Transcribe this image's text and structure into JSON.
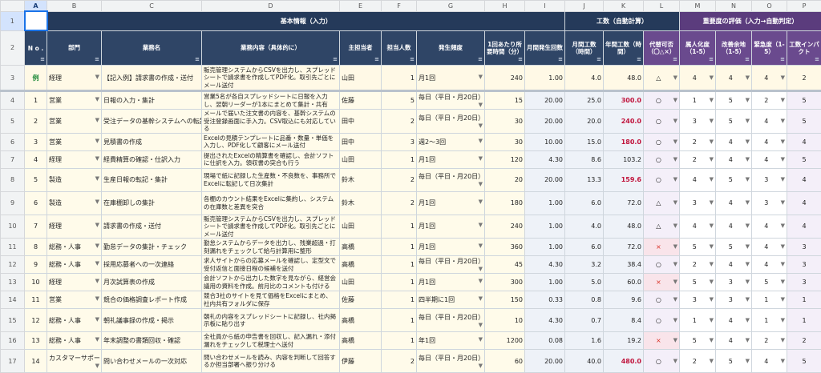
{
  "columns": [
    "A",
    "B",
    "C",
    "D",
    "E",
    "F",
    "G",
    "H",
    "I",
    "J",
    "K",
    "L",
    "M",
    "N",
    "O",
    "P"
  ],
  "selected_column": "A",
  "groups": {
    "basic": "基本情報（入力）",
    "effort": "工数（自動計算）",
    "priority": "重要度の評価（入力→自動判定）"
  },
  "headers": {
    "no": "N o .",
    "dept": "部門",
    "task": "業務名",
    "detail": "業務内容（具体的に）",
    "owner": "主担当者",
    "staff": "担当人数",
    "freq": "発生頻度",
    "time": "1回あたり所要時間（分）",
    "monthly_count": "月間発生回数",
    "monthly_hours": "月間工数（時間）",
    "annual_hours": "年間工数（時間）",
    "automate": "代替可否（〇△×）",
    "personalized": "属人化度（1-5）",
    "room": "改善余地（1-5）",
    "urgency": "緊急度（1-5）",
    "impact": "工数インパクト"
  },
  "example": {
    "rownum": "3",
    "no": "例",
    "dept": "経理",
    "task": "【記入例】請求書の作成・送付",
    "detail": "販売管理システムからCSVを出力し、スプレッドシートで請求書を作成してPDF化。取引先ごとにメール送付",
    "owner": "山田",
    "staff": "1",
    "freq": "月1回",
    "time": "240",
    "monthly_count": "1.00",
    "monthly_hours": "4.0",
    "annual_hours": "48.0",
    "automate": "△",
    "personalized": "4",
    "room": "4",
    "urgency": "4",
    "impact": "2"
  },
  "rows": [
    {
      "rownum": "4",
      "no": "1",
      "dept": "営業",
      "task": "日報の入力・集計",
      "detail": "営業5名が各自スプレッドシートに日報を入力し、翌朝リーダーが1本にまとめて集計・共有",
      "owner": "佐藤",
      "staff": "5",
      "freq": "毎日（平日・月20日）",
      "time": "15",
      "mc": "20.00",
      "mh": "25.0",
      "ah": "300.0",
      "auto": "○",
      "p": "1",
      "r": "5",
      "u": "2",
      "i": "5",
      "red": true,
      "pink": false
    },
    {
      "rownum": "5",
      "no": "2",
      "dept": "営業",
      "task": "受注データの基幹システムへの転記",
      "detail": "メールで届いた注文書の内容を、基幹システムの受注登録画面に手入力。CSV取込にも対応している",
      "owner": "田中",
      "staff": "2",
      "freq": "毎日（平日・月20日）",
      "time": "30",
      "mc": "20.00",
      "mh": "20.0",
      "ah": "240.0",
      "auto": "○",
      "p": "3",
      "r": "5",
      "u": "4",
      "i": "5",
      "red": true,
      "pink": false
    },
    {
      "rownum": "6",
      "no": "3",
      "dept": "営業",
      "task": "見積書の作成",
      "detail": "Excelの見積テンプレートに品番・数量・単価を入力し、PDF化して顧客にメール送付",
      "owner": "田中",
      "staff": "3",
      "freq": "週2〜3回",
      "time": "30",
      "mc": "10.00",
      "mh": "15.0",
      "ah": "180.0",
      "auto": "○",
      "p": "2",
      "r": "4",
      "u": "4",
      "i": "4",
      "red": true,
      "pink": false
    },
    {
      "rownum": "7",
      "no": "4",
      "dept": "経理",
      "task": "経費精算の確認・仕訳入力",
      "detail": "提出されたExcelの精算書を確認し、会計ソフトに仕訳を入力。領収書の突合も行う",
      "owner": "山田",
      "staff": "1",
      "freq": "月1回",
      "time": "120",
      "mc": "4.30",
      "mh": "8.6",
      "ah": "103.2",
      "auto": "○",
      "p": "2",
      "r": "4",
      "u": "4",
      "i": "5",
      "red": false,
      "pink": false
    },
    {
      "rownum": "8",
      "no": "5",
      "dept": "製造",
      "task": "生産日報の転記・集計",
      "detail": "現場で紙に記録した生産数・不良数を、事務所でExcelに転記して日次集計",
      "owner": "鈴木",
      "staff": "2",
      "freq": "毎日（平日・月20日）",
      "time": "20",
      "mc": "20.00",
      "mh": "13.3",
      "ah": "159.6",
      "auto": "○",
      "p": "4",
      "r": "5",
      "u": "3",
      "i": "4",
      "red": true,
      "pink": false
    },
    {
      "rownum": "9",
      "no": "6",
      "dept": "製造",
      "task": "在庫棚卸しの集計",
      "detail": "各棚のカウント結果をExcelに集約し、システムの在庫数と差異を突合",
      "owner": "鈴木",
      "staff": "2",
      "freq": "月1回",
      "time": "180",
      "mc": "1.00",
      "mh": "6.0",
      "ah": "72.0",
      "auto": "△",
      "p": "3",
      "r": "4",
      "u": "3",
      "i": "4",
      "red": false,
      "pink": false
    },
    {
      "rownum": "10",
      "no": "7",
      "dept": "経理",
      "task": "請求書の作成・送付",
      "detail": "販売管理システムからCSVを出力し、スプレッドシートで請求書を作成してPDF化。取引先ごとにメール送付",
      "owner": "山田",
      "staff": "1",
      "freq": "月1回",
      "time": "240",
      "mc": "1.00",
      "mh": "4.0",
      "ah": "48.0",
      "auto": "△",
      "p": "4",
      "r": "4",
      "u": "4",
      "i": "4",
      "red": false,
      "pink": false
    },
    {
      "rownum": "11",
      "no": "8",
      "dept": "総務・人事",
      "task": "勤怠データの集計・チェック",
      "detail": "勤怠システムからデータを出力し、残業超過・打刻漏れをチェックして給与計算用に整形",
      "owner": "高橋",
      "staff": "1",
      "freq": "月1回",
      "time": "360",
      "mc": "1.00",
      "mh": "6.0",
      "ah": "72.0",
      "auto": "×",
      "p": "5",
      "r": "5",
      "u": "4",
      "i": "3",
      "red": false,
      "pink": true
    },
    {
      "rownum": "12",
      "no": "9",
      "dept": "総務・人事",
      "task": "採用応募者への一次連絡",
      "detail": "求人サイトからの応募メールを確認し、定型文で受付返信と面接日程の候補を送付",
      "owner": "高橋",
      "staff": "1",
      "freq": "毎日（平日・月20日）",
      "time": "45",
      "mc": "4.30",
      "mh": "3.2",
      "ah": "38.4",
      "auto": "○",
      "p": "2",
      "r": "4",
      "u": "4",
      "i": "3",
      "red": false,
      "pink": false
    },
    {
      "rownum": "13",
      "no": "10",
      "dept": "経理",
      "task": "月次試算表の作成",
      "detail": "会計ソフトから出力した数字を見ながら、経営会議用の資料を作成。前月比のコメントも付ける",
      "owner": "山田",
      "staff": "1",
      "freq": "月1回",
      "time": "300",
      "mc": "1.00",
      "mh": "5.0",
      "ah": "60.0",
      "auto": "×",
      "p": "5",
      "r": "3",
      "u": "5",
      "i": "3",
      "red": false,
      "pink": true
    },
    {
      "rownum": "14",
      "no": "11",
      "dept": "営業",
      "task": "競合の価格調査レポート作成",
      "detail": "競合3社のサイトを見て価格をExcelにまとめ、社内共有フォルダに保存",
      "owner": "佐藤",
      "staff": "1",
      "freq": "四半期に1回",
      "time": "150",
      "mc": "0.33",
      "mh": "0.8",
      "ah": "9.6",
      "auto": "○",
      "p": "3",
      "r": "3",
      "u": "1",
      "i": "1",
      "red": false,
      "pink": false
    },
    {
      "rownum": "15",
      "no": "12",
      "dept": "総務・人事",
      "task": "朝礼議事録の作成・掲示",
      "detail": "朝礼の内容をスプレッドシートに記録し、社内掲示板に貼り出す",
      "owner": "高橋",
      "staff": "1",
      "freq": "毎日（平日・月20日）",
      "time": "10",
      "mc": "4.30",
      "mh": "0.7",
      "ah": "8.4",
      "auto": "○",
      "p": "1",
      "r": "4",
      "u": "1",
      "i": "1",
      "red": false,
      "pink": false
    },
    {
      "rownum": "16",
      "no": "13",
      "dept": "総務・人事",
      "task": "年末調整の書類回収・確認",
      "detail": "全社員から紙の申告書を回収し、記入漏れ・添付漏れをチェックして税理士へ送付",
      "owner": "高橋",
      "staff": "1",
      "freq": "年1回",
      "time": "1200",
      "mc": "0.08",
      "mh": "1.6",
      "ah": "19.2",
      "auto": "×",
      "p": "5",
      "r": "4",
      "u": "2",
      "i": "2",
      "red": false,
      "pink": true
    },
    {
      "rownum": "17",
      "no": "14",
      "dept": "カスタマーサポート",
      "task": "問い合わせメールの一次対応",
      "detail": "問い合わせメールを読み、内容を判断して回答するか担当部署へ振り分ける",
      "owner": "伊藤",
      "staff": "2",
      "freq": "毎日（平日・月20日）",
      "time": "60",
      "mc": "20.00",
      "mh": "40.0",
      "ah": "480.0",
      "auto": "○",
      "p": "2",
      "r": "5",
      "u": "4",
      "i": "5",
      "red": true,
      "pink": false
    }
  ]
}
